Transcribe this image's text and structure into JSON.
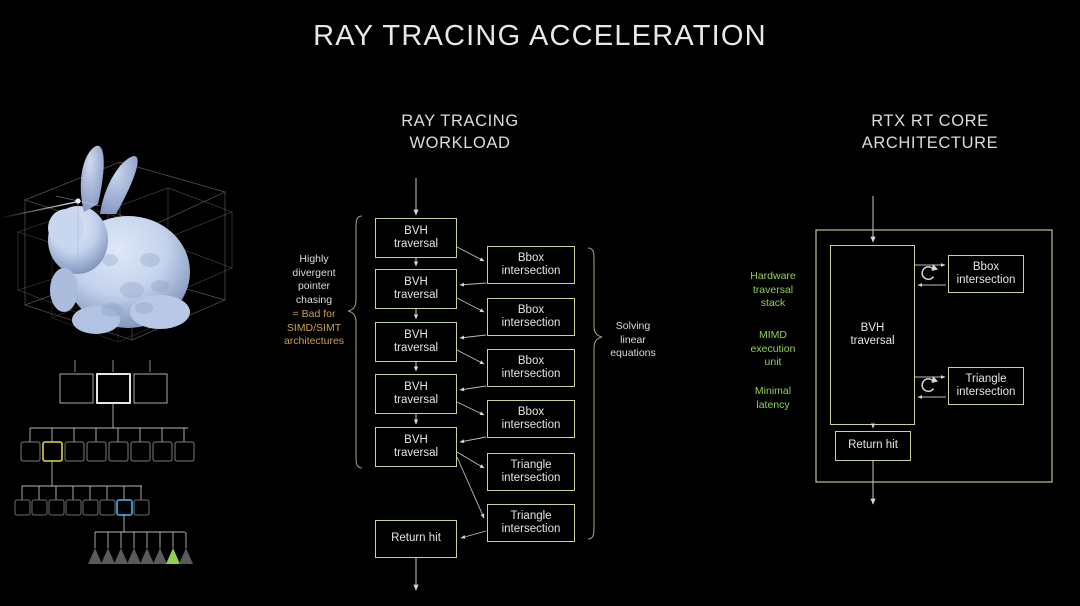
{
  "slide": {
    "title": "RAY TRACING ACCELERATION",
    "background_color": "#000000",
    "box_border_color": "#cfcf9a",
    "text_color": "#e4e4e4",
    "gold_color": "#c8a24a",
    "green_color": "#8fd14f"
  },
  "columns": {
    "workload": {
      "title_line1": "RAY TRACING",
      "title_line2": "WORKLOAD"
    },
    "rtx": {
      "title_line1": "RTX RT CORE",
      "title_line2": "ARCHITECTURE"
    }
  },
  "workload_diagram": {
    "traversal_boxes": [
      {
        "line1": "BVH",
        "line2": "traversal"
      },
      {
        "line1": "BVH",
        "line2": "traversal"
      },
      {
        "line1": "BVH",
        "line2": "traversal"
      },
      {
        "line1": "BVH",
        "line2": "traversal"
      },
      {
        "line1": "BVH",
        "line2": "traversal"
      }
    ],
    "intersection_boxes": [
      {
        "line1": "Bbox",
        "line2": "intersection"
      },
      {
        "line1": "Bbox",
        "line2": "intersection"
      },
      {
        "line1": "Bbox",
        "line2": "intersection"
      },
      {
        "line1": "Bbox",
        "line2": "intersection"
      },
      {
        "line1": "Triangle",
        "line2": "intersection"
      },
      {
        "line1": "Triangle",
        "line2": "intersection"
      }
    ],
    "return_box": {
      "line1": "Return hit"
    },
    "left_annotation": {
      "white_lines": [
        "Highly",
        "divergent",
        "pointer",
        "chasing"
      ],
      "gold_lines": [
        "= Bad for",
        "SIMD/SIMT",
        "architectures"
      ]
    },
    "right_annotation": {
      "lines": [
        "Solving",
        "linear",
        "equations"
      ]
    }
  },
  "rtx_diagram": {
    "traversal_box": {
      "line1": "BVH",
      "line2": "traversal"
    },
    "bbox_box": {
      "line1": "Bbox",
      "line2": "intersection"
    },
    "triangle_box": {
      "line1": "Triangle",
      "line2": "intersection"
    },
    "return_box": {
      "line1": "Return hit"
    },
    "loop_icon_name": "refresh-loop-icon",
    "annotations": [
      {
        "lines": [
          "Hardware",
          "traversal",
          "stack"
        ]
      },
      {
        "lines": [
          "MIMD",
          "execution",
          "unit"
        ]
      },
      {
        "lines": [
          "Minimal",
          "latency"
        ]
      }
    ]
  },
  "bvh_illustration": {
    "caption": "",
    "model_name": "stanford-bunny",
    "tree_levels": [
      {
        "count": 3,
        "highlight_index": 1,
        "highlight_color": "#ffffff"
      },
      {
        "count": 8,
        "highlight_index": 1,
        "highlight_color": "#d8d84a"
      },
      {
        "count": 8,
        "highlight_index": 6,
        "highlight_color": "#3a9fd8"
      },
      {
        "count": 8,
        "highlight_index": 6,
        "highlight_color": "#8fd14f"
      }
    ]
  }
}
